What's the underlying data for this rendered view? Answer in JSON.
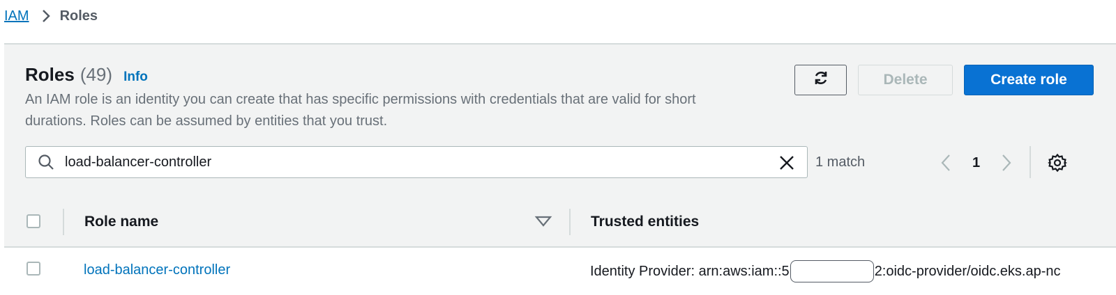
{
  "breadcrumb": {
    "root": "IAM",
    "current": "Roles"
  },
  "header": {
    "title": "Roles",
    "count": "(49)",
    "info": "Info",
    "description": "An IAM role is an identity you can create that has specific permissions with credentials that are valid for short durations. Roles can be assumed by entities that you trust."
  },
  "actions": {
    "refresh_icon": "refresh-icon",
    "delete_label": "Delete",
    "create_label": "Create role"
  },
  "search": {
    "value": "load-balancer-controller",
    "match_text": "1 match"
  },
  "pagination": {
    "current_page": "1"
  },
  "table": {
    "columns": [
      "Role name",
      "Trusted entities"
    ],
    "rows": [
      {
        "role_name": "load-balancer-controller",
        "trusted_prefix": "Identity Provider: arn:aws:iam::5",
        "trusted_suffix": "2:oidc-provider/oidc.eks.ap-nc"
      }
    ]
  },
  "colors": {
    "link": "#0073bb",
    "primary_button": "#0972d3",
    "panel_bg": "#f2f3f3",
    "border": "#d5dbdb"
  }
}
